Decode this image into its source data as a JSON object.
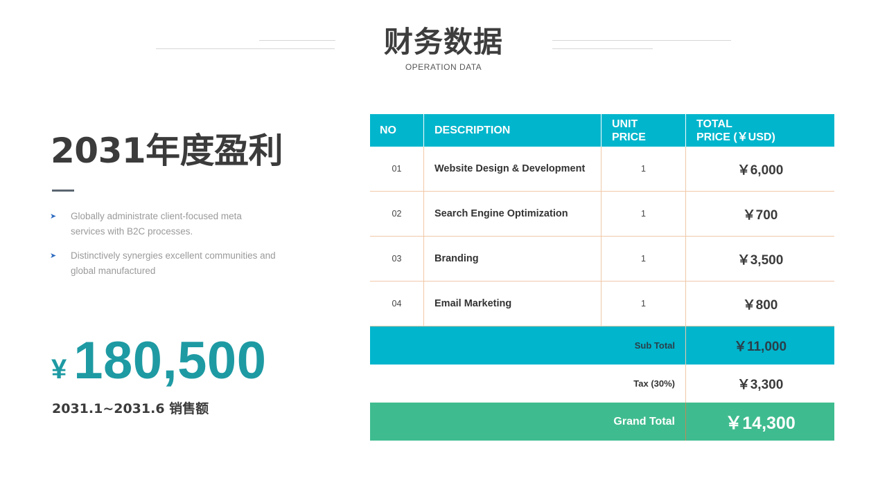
{
  "header": {
    "title": "财务数据",
    "subtitle": "OPERATION DATA"
  },
  "left": {
    "heading": "2031年度盈利",
    "bullets": [
      {
        "icon": "arrowhead-bullet-icon",
        "text": "Globally administrate client-focused meta services with B2C processes."
      },
      {
        "icon": "arrowhead-bullet-icon",
        "text": "Distinctively synergies excellent communities and global manufactured"
      }
    ],
    "amount": {
      "currency": "¥",
      "value": "180,500"
    },
    "amount_caption": "2031.1~2031.6 销售额"
  },
  "table": {
    "headers": {
      "no": "NO",
      "description": "DESCRIPTION",
      "unit_price_line1": "UNIT",
      "unit_price_line2": "PRICE",
      "total_price_line1": "TOTAL",
      "total_price_line2": "PRICE (￥USD)"
    },
    "rows": [
      {
        "no": "01",
        "description": "Website Design & Development",
        "unit_price": "1",
        "total": "￥6,000"
      },
      {
        "no": "02",
        "description": "Search Engine Optimization",
        "unit_price": "1",
        "total": "￥700"
      },
      {
        "no": "03",
        "description": "Branding",
        "unit_price": "1",
        "total": "￥3,500"
      },
      {
        "no": "04",
        "description": "Email Marketing",
        "unit_price": "1",
        "total": "￥800"
      }
    ],
    "subtotal": {
      "label": "Sub Total",
      "value": "￥11,000"
    },
    "tax": {
      "label": "Tax (30%)",
      "value": "￥3,300"
    },
    "grand_total": {
      "label": "Grand Total",
      "value": "￥14,300"
    }
  },
  "colors": {
    "accent_cyan": "#00b5cc",
    "accent_green": "#3fbc8f",
    "amount_teal": "#1e9aa3",
    "grid_orange": "#f0c8a8"
  }
}
